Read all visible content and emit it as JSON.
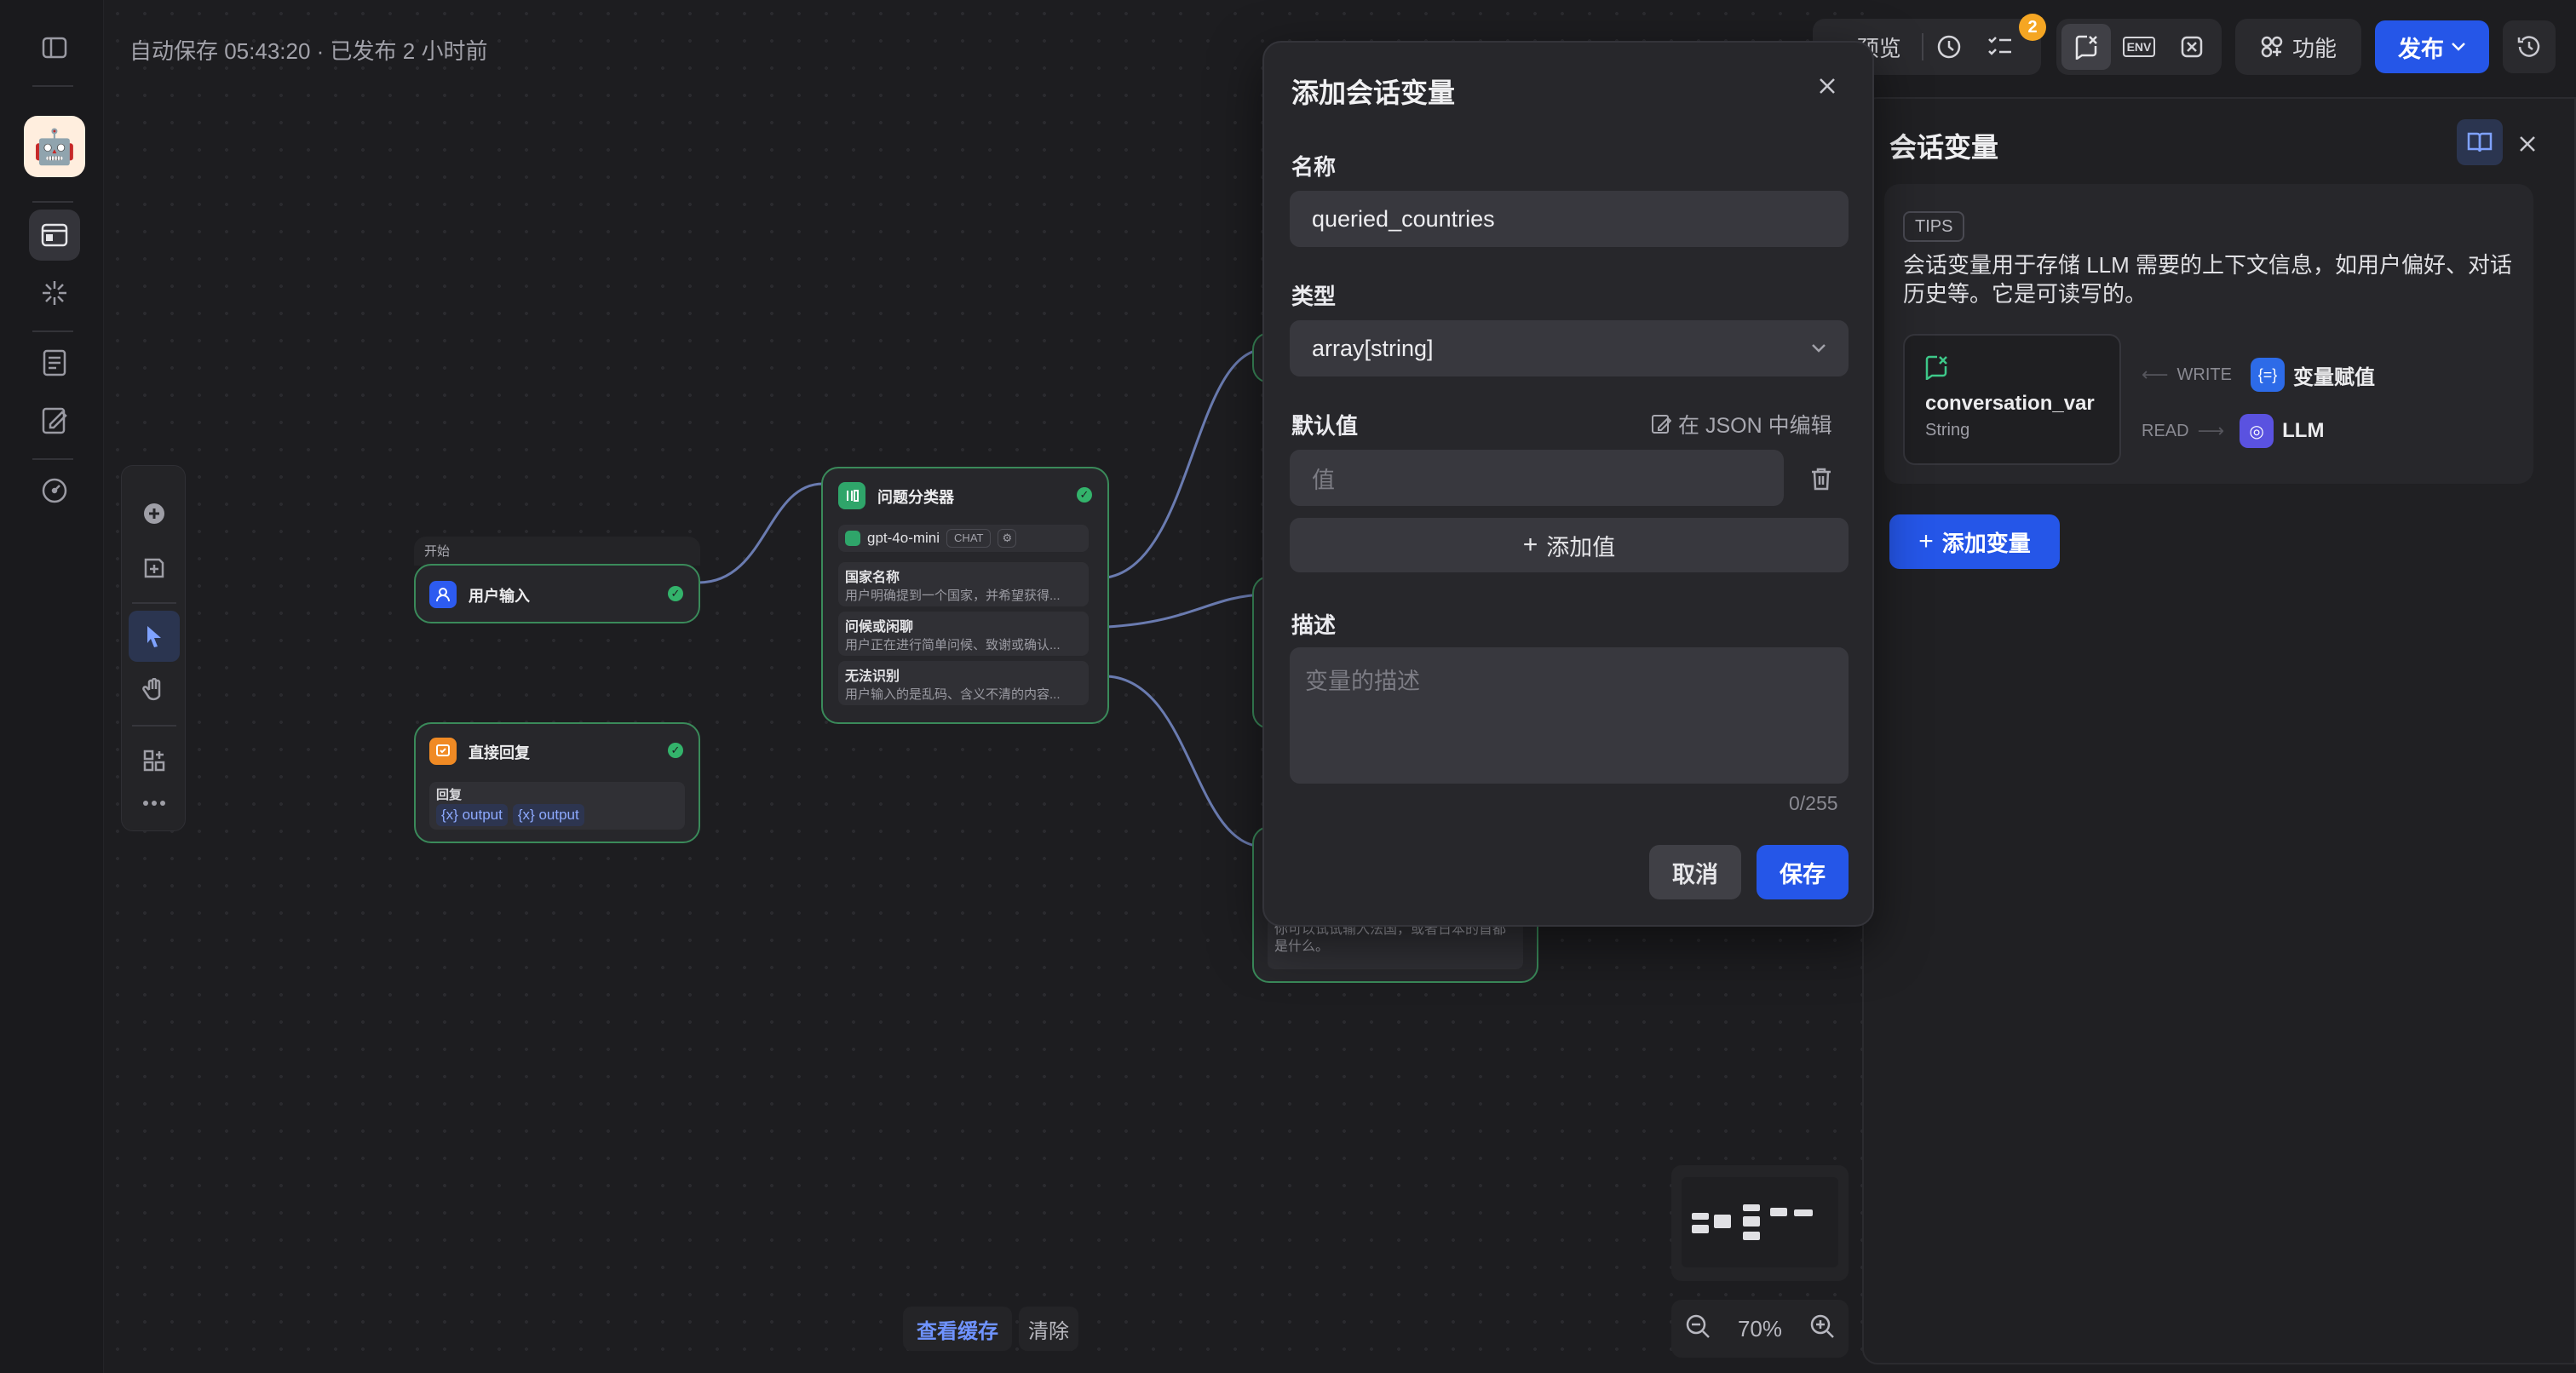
{
  "header": {
    "autosave_text": "自动保存 05:43:20 · 已发布 2 小时前"
  },
  "toolbar": {
    "preview_label": "预览",
    "issues_badge": "2",
    "env_label": "ENV",
    "features_label": "功能",
    "publish_label": "发布"
  },
  "nodes": {
    "start": {
      "tag": "开始",
      "title": "用户输入"
    },
    "classifier": {
      "title": "问题分类器",
      "model": "gpt-4o-mini",
      "model_badge": "CHAT",
      "classes": [
        {
          "title": "国家名称",
          "desc": "用户明确提到一个国家，并希望获得..."
        },
        {
          "title": "问候或闲聊",
          "desc": "用户正在进行简单问候、致谢或确认..."
        },
        {
          "title": "无法识别",
          "desc": "用户输入的是乱码、含义不清的内容..."
        }
      ]
    },
    "direct_reply": {
      "title": "直接回复",
      "label": "回复",
      "outputs": [
        "output",
        "output"
      ]
    },
    "partial_answer": {
      "text": "你可以试试输入法国，或者日本的首都是什么。"
    }
  },
  "canvas_controls": {
    "view_cache": "查看缓存",
    "clear": "清除",
    "zoom": "70%"
  },
  "modal": {
    "title": "添加会话变量",
    "name_label": "名称",
    "name_value": "queried_countries",
    "type_label": "类型",
    "type_value": "array[string]",
    "default_label": "默认值",
    "json_edit": "在 JSON 中编辑",
    "value_placeholder": "值",
    "add_value": "添加值",
    "desc_label": "描述",
    "desc_placeholder": "变量的描述",
    "counter": "0/255",
    "cancel": "取消",
    "save": "保存"
  },
  "panel": {
    "title": "会话变量",
    "tips_tag": "TIPS",
    "tips_text": "会话变量用于存储 LLM 需要的上下文信息，如用户偏好、对话历史等。它是可读写的。",
    "var_name": "conversation_var",
    "var_type": "String",
    "write_label": "WRITE",
    "write_target": "变量赋值",
    "read_label": "READ",
    "read_target": "LLM",
    "add_variable": "添加变量"
  },
  "colors": {
    "accent": "#2556e8",
    "node_border": "#3a8a5a",
    "success": "#33b36b",
    "badge": "#f5a623"
  }
}
